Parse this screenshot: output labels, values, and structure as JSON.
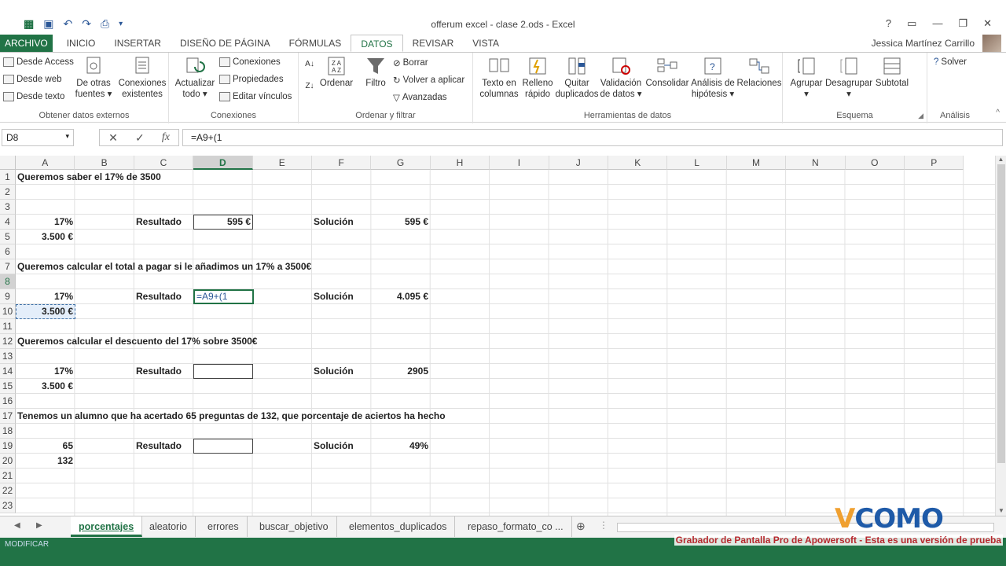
{
  "title": "offerum excel - clase 2.ods - Excel",
  "user": "Jessica Martínez Carrillo",
  "tabs": [
    "ARCHIVO",
    "INICIO",
    "INSERTAR",
    "DISEÑO DE PÁGINA",
    "FÓRMULAS",
    "DATOS",
    "REVISAR",
    "VISTA"
  ],
  "active_tab": "DATOS",
  "ribbon": {
    "ext_access": "Desde Access",
    "ext_web": "Desde web",
    "ext_text": "Desde texto",
    "other_sources_1": "De otras",
    "other_sources_2": "fuentes",
    "existing_1": "Conexiones",
    "existing_2": "existentes",
    "group_external": "Obtener datos externos",
    "refresh_1": "Actualizar",
    "refresh_2": "todo",
    "conn_connections": "Conexiones",
    "conn_properties": "Propiedades",
    "conn_edit_links": "Editar vínculos",
    "group_connections": "Conexiones",
    "sort_label": "Ordenar",
    "filter_label": "Filtro",
    "clear_label": "Borrar",
    "reapply_label": "Volver a aplicar",
    "advanced_label": "Avanzadas",
    "group_sort": "Ordenar y filtrar",
    "text_cols_1": "Texto en",
    "text_cols_2": "columnas",
    "flash_fill_1": "Relleno",
    "flash_fill_2": "rápido",
    "remove_dup_1": "Quitar",
    "remove_dup_2": "duplicados",
    "validation_1": "Validación",
    "validation_2": "de datos",
    "consolidate": "Consolidar",
    "whatif_1": "Análisis de",
    "whatif_2": "hipótesis",
    "relations": "Relaciones",
    "group_tools": "Herramientas de datos",
    "group_label": "Agrupar",
    "ungroup_label": "Desagrupar",
    "subtotal_label": "Subtotal",
    "group_outline": "Esquema",
    "solver_label": "Solver",
    "group_analysis": "Análisis"
  },
  "namebox": "D8",
  "formula": "=A9+(1",
  "columns": [
    "A",
    "B",
    "C",
    "D",
    "E",
    "F",
    "G",
    "H",
    "I",
    "J",
    "K",
    "L",
    "M",
    "N",
    "O",
    "P"
  ],
  "rows": [
    "1",
    "2",
    "3",
    "4",
    "5",
    "6",
    "7",
    "8",
    "9",
    "10",
    "11",
    "12",
    "13",
    "14",
    "15",
    "16",
    "17",
    "18",
    "19",
    "20",
    "21",
    "22",
    "23"
  ],
  "cells": {
    "a1": "Queremos saber el 17% de 3500",
    "a3": "17%",
    "c3": "Resultado",
    "d3": "595 €",
    "f3": "Solución",
    "g3": "595 €",
    "a4": "3.500 €",
    "a6": "Queremos calcular el total a pagar si le añadimos un 17% a 3500€",
    "a8": "17%",
    "c8": "Resultado",
    "d8": "=A9+(1",
    "f8": "Solución",
    "g8": "4.095 €",
    "a9": "3.500 €",
    "a11": "Queremos calcular el descuento del 17% sobre 3500€",
    "a13": "17%",
    "c13": "Resultado",
    "f13": "Solución",
    "g13": "2905",
    "a14": "3.500 €",
    "a16": "Tenemos un alumno que ha acertado 65 preguntas de 132, que porcentaje de aciertos ha hecho",
    "a18": "65",
    "c18": "Resultado",
    "f18": "Solución",
    "g18": "49%",
    "a19": "132"
  },
  "sheets": [
    "porcentajes",
    "aleatorio",
    "errores",
    "buscar_objetivo",
    "elementos_duplicados",
    "repaso_formato_co ..."
  ],
  "active_sheet": "porcentajes",
  "status": "MODIFICAR",
  "watermark": "Grabador de Pantalla Pro de Apowersoft - Esta es una versión de prueba",
  "logo": "COMO",
  "logo_prefix": "V"
}
